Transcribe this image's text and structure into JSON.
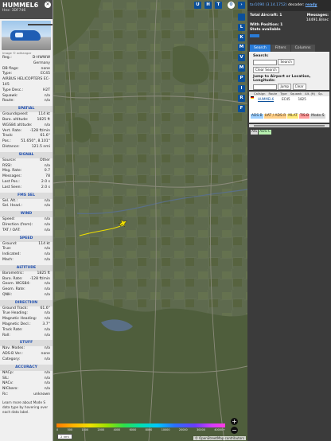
{
  "left_panel": {
    "callsign": "HUMMEL6",
    "hex_label": "Hex: 3DF746",
    "photo_caption": "Image © adhangar",
    "ident_rows": [
      {
        "k": "Reg.:",
        "v": "D-HWWW"
      },
      {
        "k": "",
        "v": "Germany"
      },
      {
        "k": "DB flags:",
        "v": "none"
      },
      {
        "k": "Type:",
        "v": "EC45"
      },
      {
        "k": "AIRBUS HELICOPTERS EC-145",
        "v": ""
      },
      {
        "k": "Type Desc.:",
        "v": "H2T"
      },
      {
        "k": "Squawk:",
        "v": "n/a"
      },
      {
        "k": "Route:",
        "v": "n/a"
      }
    ],
    "sections": [
      {
        "title": "SPATIAL",
        "rows": [
          {
            "k": "Groundspeed:",
            "v": "114 kt"
          },
          {
            "k": "Baro. altitude:",
            "v": "1825 ft"
          },
          {
            "k": "WGS84 altitude:",
            "v": "n/a"
          },
          {
            "k": "Vert. Rate:",
            "v": "-128 ft/min"
          },
          {
            "k": "Track:",
            "v": "61.6°"
          },
          {
            "k": "Pos.:",
            "v": "51.650°, 8.101°"
          },
          {
            "k": "Distance:",
            "v": "121.5 nmi"
          }
        ]
      },
      {
        "title": "SIGNAL",
        "rows": [
          {
            "k": "Source:",
            "v": "Other"
          },
          {
            "k": "RSSI:",
            "v": "n/a"
          },
          {
            "k": "Msg. Rate:",
            "v": "0.7"
          },
          {
            "k": "Messages:",
            "v": "78"
          },
          {
            "k": "Last Pos.:",
            "v": "2.0 s"
          },
          {
            "k": "Last Seen:",
            "v": "2.0 s"
          }
        ]
      },
      {
        "title": "FMS SEL",
        "rows": [
          {
            "k": "Sel. Alt.:",
            "v": "n/a"
          },
          {
            "k": "Sel. Head.:",
            "v": "n/a"
          }
        ]
      },
      {
        "title": "WIND",
        "rows": [
          {
            "k": "Speed:",
            "v": "n/a"
          },
          {
            "k": "Direction (from):",
            "v": "n/a"
          },
          {
            "k": "TAT / OAT:",
            "v": "n/a"
          }
        ]
      },
      {
        "title": "SPEED",
        "rows": [
          {
            "k": "Ground:",
            "v": "114 kt"
          },
          {
            "k": "True:",
            "v": "n/a"
          },
          {
            "k": "Indicated:",
            "v": "n/a"
          },
          {
            "k": "Mach:",
            "v": "n/a"
          }
        ]
      },
      {
        "title": "ALTITUDE",
        "rows": [
          {
            "k": "Barometric:",
            "v": "1825 ft"
          },
          {
            "k": "Baro. Rate:",
            "v": "-128 ft/min"
          },
          {
            "k": "Geom. WGS84:",
            "v": "n/a"
          },
          {
            "k": "Geom. Rate:",
            "v": "n/a"
          },
          {
            "k": "QNH:",
            "v": "n/a"
          }
        ]
      },
      {
        "title": "DIRECTION",
        "rows": [
          {
            "k": "Ground Track:",
            "v": "61.6°"
          },
          {
            "k": "True Heading:",
            "v": "n/a"
          },
          {
            "k": "Magnetic Heading:",
            "v": "n/a"
          },
          {
            "k": "Magnetic Decl.:",
            "v": "3.7°"
          },
          {
            "k": "Track Rate:",
            "v": "n/a"
          },
          {
            "k": "Roll:",
            "v": "n/a"
          }
        ]
      },
      {
        "title": "STUFF",
        "rows": [
          {
            "k": "Nav. Modes:",
            "v": "n/a"
          },
          {
            "k": "ADS-B Ver.:",
            "v": "none"
          },
          {
            "k": "Category:",
            "v": "n/a"
          }
        ]
      },
      {
        "title": "ACCURACY",
        "rows": [
          {
            "k": "NACp:",
            "v": "n/a"
          },
          {
            "k": "SIL:",
            "v": "n/a"
          },
          {
            "k": "NACv:",
            "v": "n/a"
          },
          {
            "k": "NICbaro:",
            "v": "n/a"
          },
          {
            "k": "Rc:",
            "v": "unknown"
          }
        ]
      }
    ],
    "footer": "Learn more about Mode S data type by hovering over each data label."
  },
  "map": {
    "top_buttons": [
      "U",
      "H",
      "T"
    ],
    "side_buttons": [
      "",
      "L",
      "K",
      "M",
      "V",
      "M",
      "P",
      "I",
      "R",
      "F"
    ],
    "zoom_in": "+",
    "zoom_out": "−",
    "altitude_ticks": [
      "0",
      "500",
      "1000",
      "2000",
      "4000",
      "6000",
      "8000",
      "10000",
      "20000",
      "30000",
      "40000+"
    ],
    "scale_label": "2 nmi",
    "attribution": "© OpenStreetMap contributors"
  },
  "right_panel": {
    "version": "tar1090 (3.14.1752)",
    "decoder": "decoder:",
    "ready": "ready",
    "total_label": "Total Aircraft: 1",
    "messages_label": "Messages:",
    "messages_value": "14491.8/sec",
    "with_position": "With Position: 1",
    "stats_available": "Stats available",
    "tabs": [
      "Search",
      "Filters",
      "Columns"
    ],
    "search_label": "Search:",
    "search_button": "Search",
    "clear_search": "Clear Search",
    "jump_label": "Jump to Airport or Location, Longitude:",
    "jump_button": "Jump",
    "clear_button": "Clear",
    "table_headers": [
      "Callsign",
      "Route",
      "Type",
      "Squawk",
      "Alt. (ft)",
      "Sp."
    ],
    "table_row": [
      "HUMMEL6",
      "",
      "EC45",
      "",
      "1825",
      ""
    ],
    "sources": [
      "ADS-B",
      "UAT / ADS-R",
      "MLAT",
      "TIS-B",
      "Mode-S",
      "AIS",
      "ADS-C"
    ]
  },
  "colors": {
    "accent": "#2a7bd6",
    "button_blue": "#0b4f9a",
    "track": "#f0e000"
  }
}
